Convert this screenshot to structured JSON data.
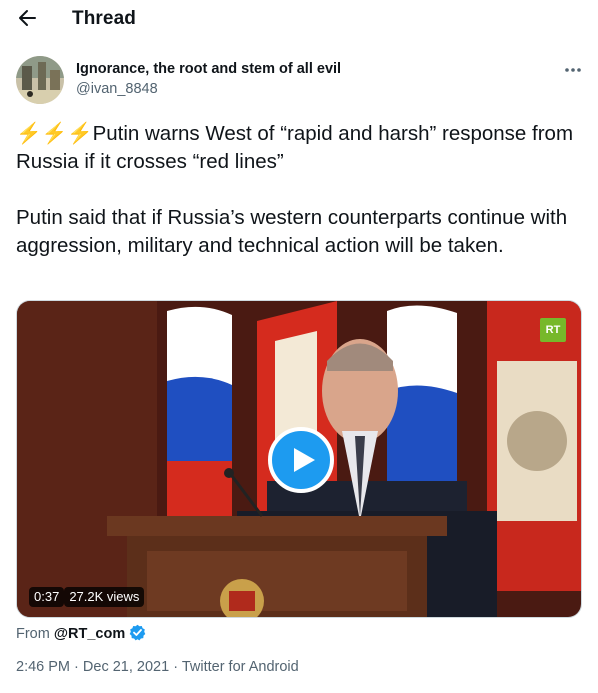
{
  "header": {
    "title": "Thread",
    "back_icon": "arrow-left-icon"
  },
  "author": {
    "name": "Ignorance, the root and stem of all evil",
    "handle": "@ivan_8848"
  },
  "more_icon": "more-horizontal-icon",
  "tweet": {
    "emoji": "⚡⚡⚡",
    "line1": "Putin warns West of “rapid and harsh” response from Russia if it crosses “red lines”",
    "line2": "Putin said that if Russia’s western counterparts continue with aggression, military and technical action will be taken."
  },
  "video": {
    "duration": "0:37",
    "views": "27.2K views",
    "channel_logo": "RT",
    "play_icon": "play-icon"
  },
  "source": {
    "prefix": "From",
    "account": "@RT_com",
    "verified_icon": "verified-badge-icon"
  },
  "meta": {
    "time": "2:46 PM",
    "date": "Dec 21, 2021",
    "client": "Twitter for Android",
    "separator": "·"
  },
  "colors": {
    "accent": "#1d9bf0",
    "secondary_text": "#536471",
    "rt_green": "#77b82a"
  }
}
